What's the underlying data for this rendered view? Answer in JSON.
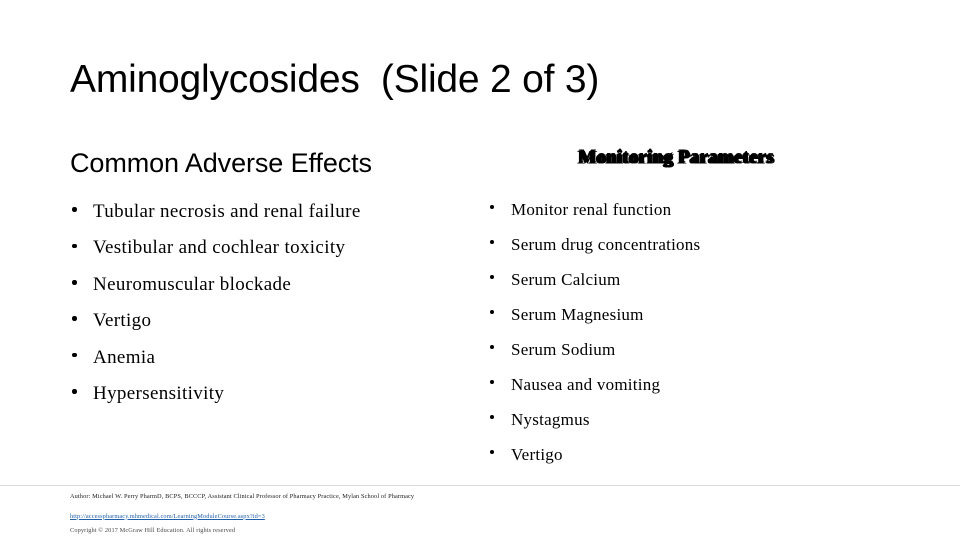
{
  "slide": {
    "title": "Aminoglycosides  (Slide 2 of 3)",
    "background_color": "#ffffff",
    "text_color": "#000000"
  },
  "columns": {
    "left": {
      "header": "Common Adverse Effects",
      "bullets": [
        "Tubular necrosis and renal failure",
        "Vestibular and cochlear toxicity",
        "Neuromuscular blockade",
        "Vertigo",
        "Anemia",
        "Hypersensitivity"
      ]
    },
    "right": {
      "header": "Monitoring Parameters",
      "bullets": [
        "Monitor renal function",
        "Serum drug concentrations",
        "Serum Calcium",
        "Serum Magnesium",
        "Serum Sodium",
        "Nausea and vomiting",
        "Nystagmus",
        "Vertigo"
      ]
    }
  },
  "footer": {
    "author": "Author: Michael W. Perry PharmD, BCPS, BCCCP, Assistant Clinical Professor of Pharmacy Practice, Mylan School of Pharmacy",
    "link_text": "http://accesspharmacy.mhmedical.com/LearningModuleCourse.aspx?id=3",
    "link_color": "#1f5fa9",
    "copyright": "Copyright © 2017 McGraw Hill Education. All rights reserved",
    "divider_color": "#d9d9d9"
  }
}
